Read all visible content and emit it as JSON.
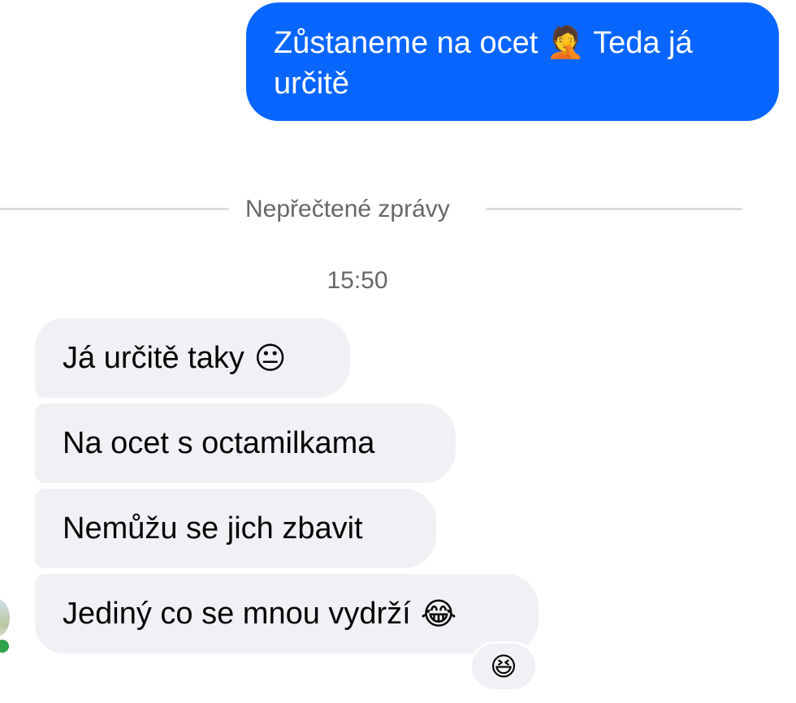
{
  "sent_message": {
    "text_part1": "Zůstaneme na ocet",
    "emoji": "🤦",
    "text_part2": "Teda já určitě"
  },
  "divider": {
    "label": "Nepřečtené zprávy"
  },
  "timestamp": "15:50",
  "received_messages": [
    {
      "text": "Já určitě taky",
      "emoji": "😐"
    },
    {
      "text": "Na ocet s octamilkama",
      "emoji": ""
    },
    {
      "text": "Nemůžu se jich zbavit",
      "emoji": ""
    },
    {
      "text": "Jediný co se mnou vydrží",
      "emoji": "😂"
    }
  ],
  "reaction": {
    "emoji": "😆"
  },
  "colors": {
    "sent_bubble": "#0866ff",
    "received_bubble": "#f0f0f5",
    "online_indicator": "#31a24c"
  },
  "icons": {
    "avatar": "contact-avatar",
    "status": "online-status-dot"
  }
}
